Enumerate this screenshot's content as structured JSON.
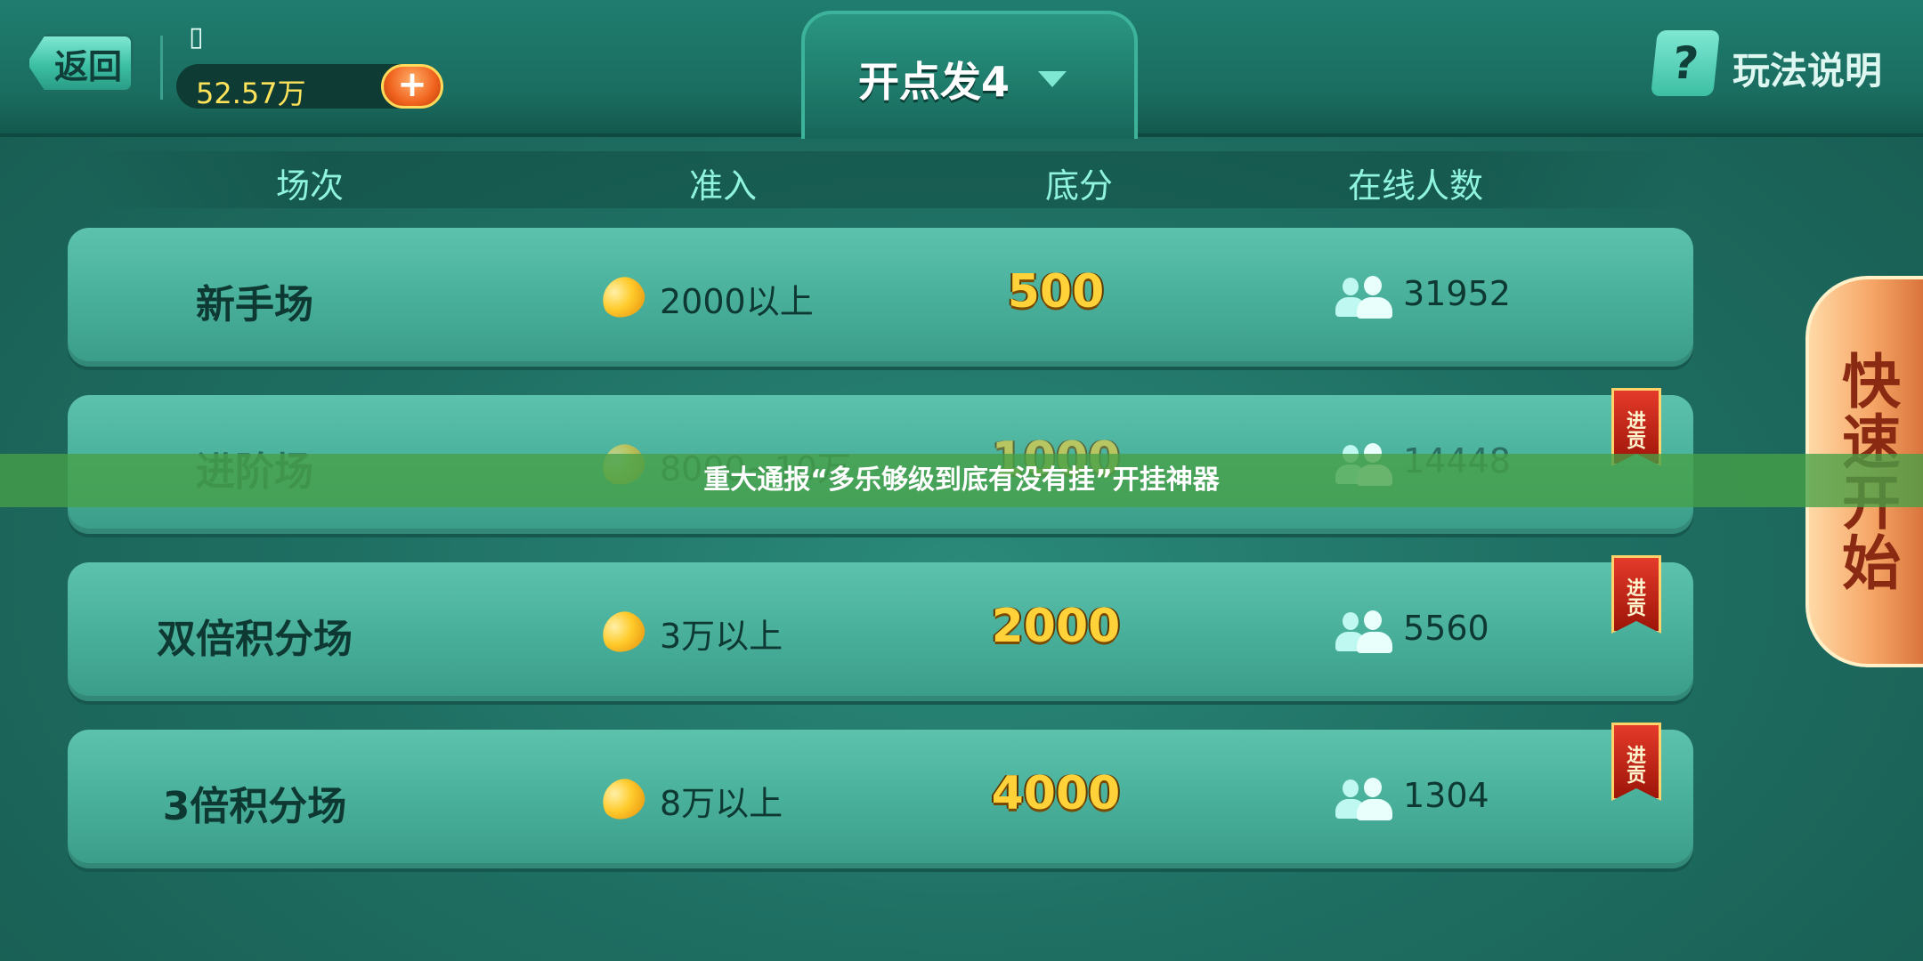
{
  "header": {
    "back_label": "返回",
    "user_glyph": "▯",
    "coins": "52.57万",
    "add_symbol": "+",
    "mode_title": "开点发4",
    "help_symbol": "?",
    "help_label": "玩法说明"
  },
  "columns": [
    "场次",
    "准入",
    "底分",
    "在线人数"
  ],
  "rooms": [
    {
      "name": "新手场",
      "entry": "2000以上",
      "base": "500",
      "online": "31952",
      "tribute": ""
    },
    {
      "name": "进阶场",
      "entry": "8000~10万",
      "base": "1000",
      "online": "14448",
      "tribute": "进贡"
    },
    {
      "name": "双倍积分场",
      "entry": "3万以上",
      "base": "2000",
      "online": "5560",
      "tribute": "进贡"
    },
    {
      "name": "3倍积分场",
      "entry": "8万以上",
      "base": "4000",
      "online": "1304",
      "tribute": "进贡"
    }
  ],
  "quick_start_label": "快速开始",
  "banner_text": "重大通报“多乐够级到底有没有挂”开挂神器"
}
